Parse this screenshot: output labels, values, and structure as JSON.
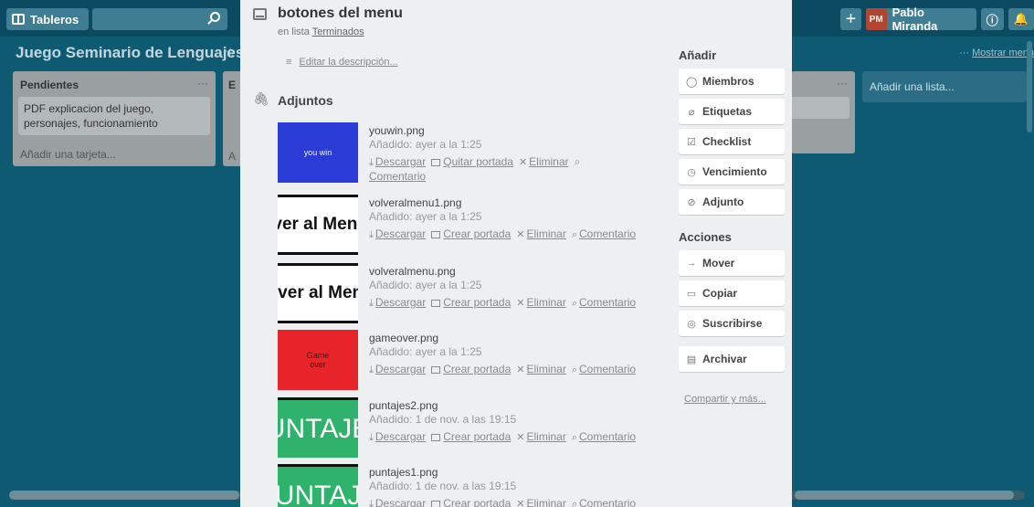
{
  "header": {
    "boards_label": "Tableros",
    "user_initials": "PM",
    "user_name": "Pablo Miranda"
  },
  "board": {
    "title": "Juego Seminario de Lenguajes",
    "show_menu_dots": "···",
    "show_menu": "Mostrar menú",
    "lists": [
      {
        "title": "Pendientes",
        "dots": "···",
        "card": "PDF explicacion del juego, personajes, funcionamiento",
        "add_card": "Añadir una tarjeta..."
      },
      {
        "title": "E",
        "add_card": "A"
      }
    ],
    "right_list_dots": "···",
    "add_list": "Añadir una lista..."
  },
  "modal": {
    "title": "botones del menu",
    "in_list_prefix": "en lista",
    "in_list_name": "Terminados",
    "edit_description": "Editar la descripción...",
    "attachments_title": "Adjuntos",
    "attachments": [
      {
        "name": "youwin.png",
        "added": "Añadido: ayer a la 1:25",
        "thumb_text": "you win",
        "thumb_bg": "#2b3bd6",
        "thumb_color": "#f2f2f2",
        "cover_action": "Quitar portada"
      },
      {
        "name": "volveralmenu1.png",
        "added": "Añadido: ayer a la 1:25",
        "thumb_text": "lver al Menu",
        "thumb_bg": "#ffffff",
        "thumb_color": "#111111",
        "cover_action": "Crear portada"
      },
      {
        "name": "volveralmenu.png",
        "added": "Añadido: ayer a la 1:25",
        "thumb_text": "olver al Menu",
        "thumb_bg": "#ffffff",
        "thumb_color": "#111111",
        "cover_action": "Crear portada"
      },
      {
        "name": "gameover.png",
        "added": "Añadido: ayer a la 1:25",
        "thumb_text": "Game over",
        "thumb_bg": "#e8242b",
        "thumb_color": "#222222",
        "cover_action": "Crear portada"
      },
      {
        "name": "puntajes2.png",
        "added": "Añadido: 1 de nov. a las 19:15",
        "thumb_text": "UNTAJE",
        "thumb_bg": "#2fb36c",
        "thumb_color": "#ffffff",
        "cover_action": "Crear portada"
      },
      {
        "name": "puntajes1.png",
        "added": "Añadido: 1 de nov. a las 19:15",
        "thumb_text": "UNTAJ",
        "thumb_bg": "#2fb36c",
        "thumb_color": "#ffffff",
        "cover_action": "Crear portada"
      }
    ],
    "action_download": "Descargar",
    "action_delete": "Eliminar",
    "action_comment": "Comentario",
    "sidebar": {
      "add_title": "Añadir",
      "members": "Miembros",
      "labels": "Etiquetas",
      "checklist": "Checklist",
      "due_date": "Vencimiento",
      "attachment": "Adjunto",
      "actions_title": "Acciones",
      "move": "Mover",
      "copy": "Copiar",
      "subscribe": "Suscribirse",
      "archive": "Archivar",
      "share": "Compartir y más..."
    }
  }
}
